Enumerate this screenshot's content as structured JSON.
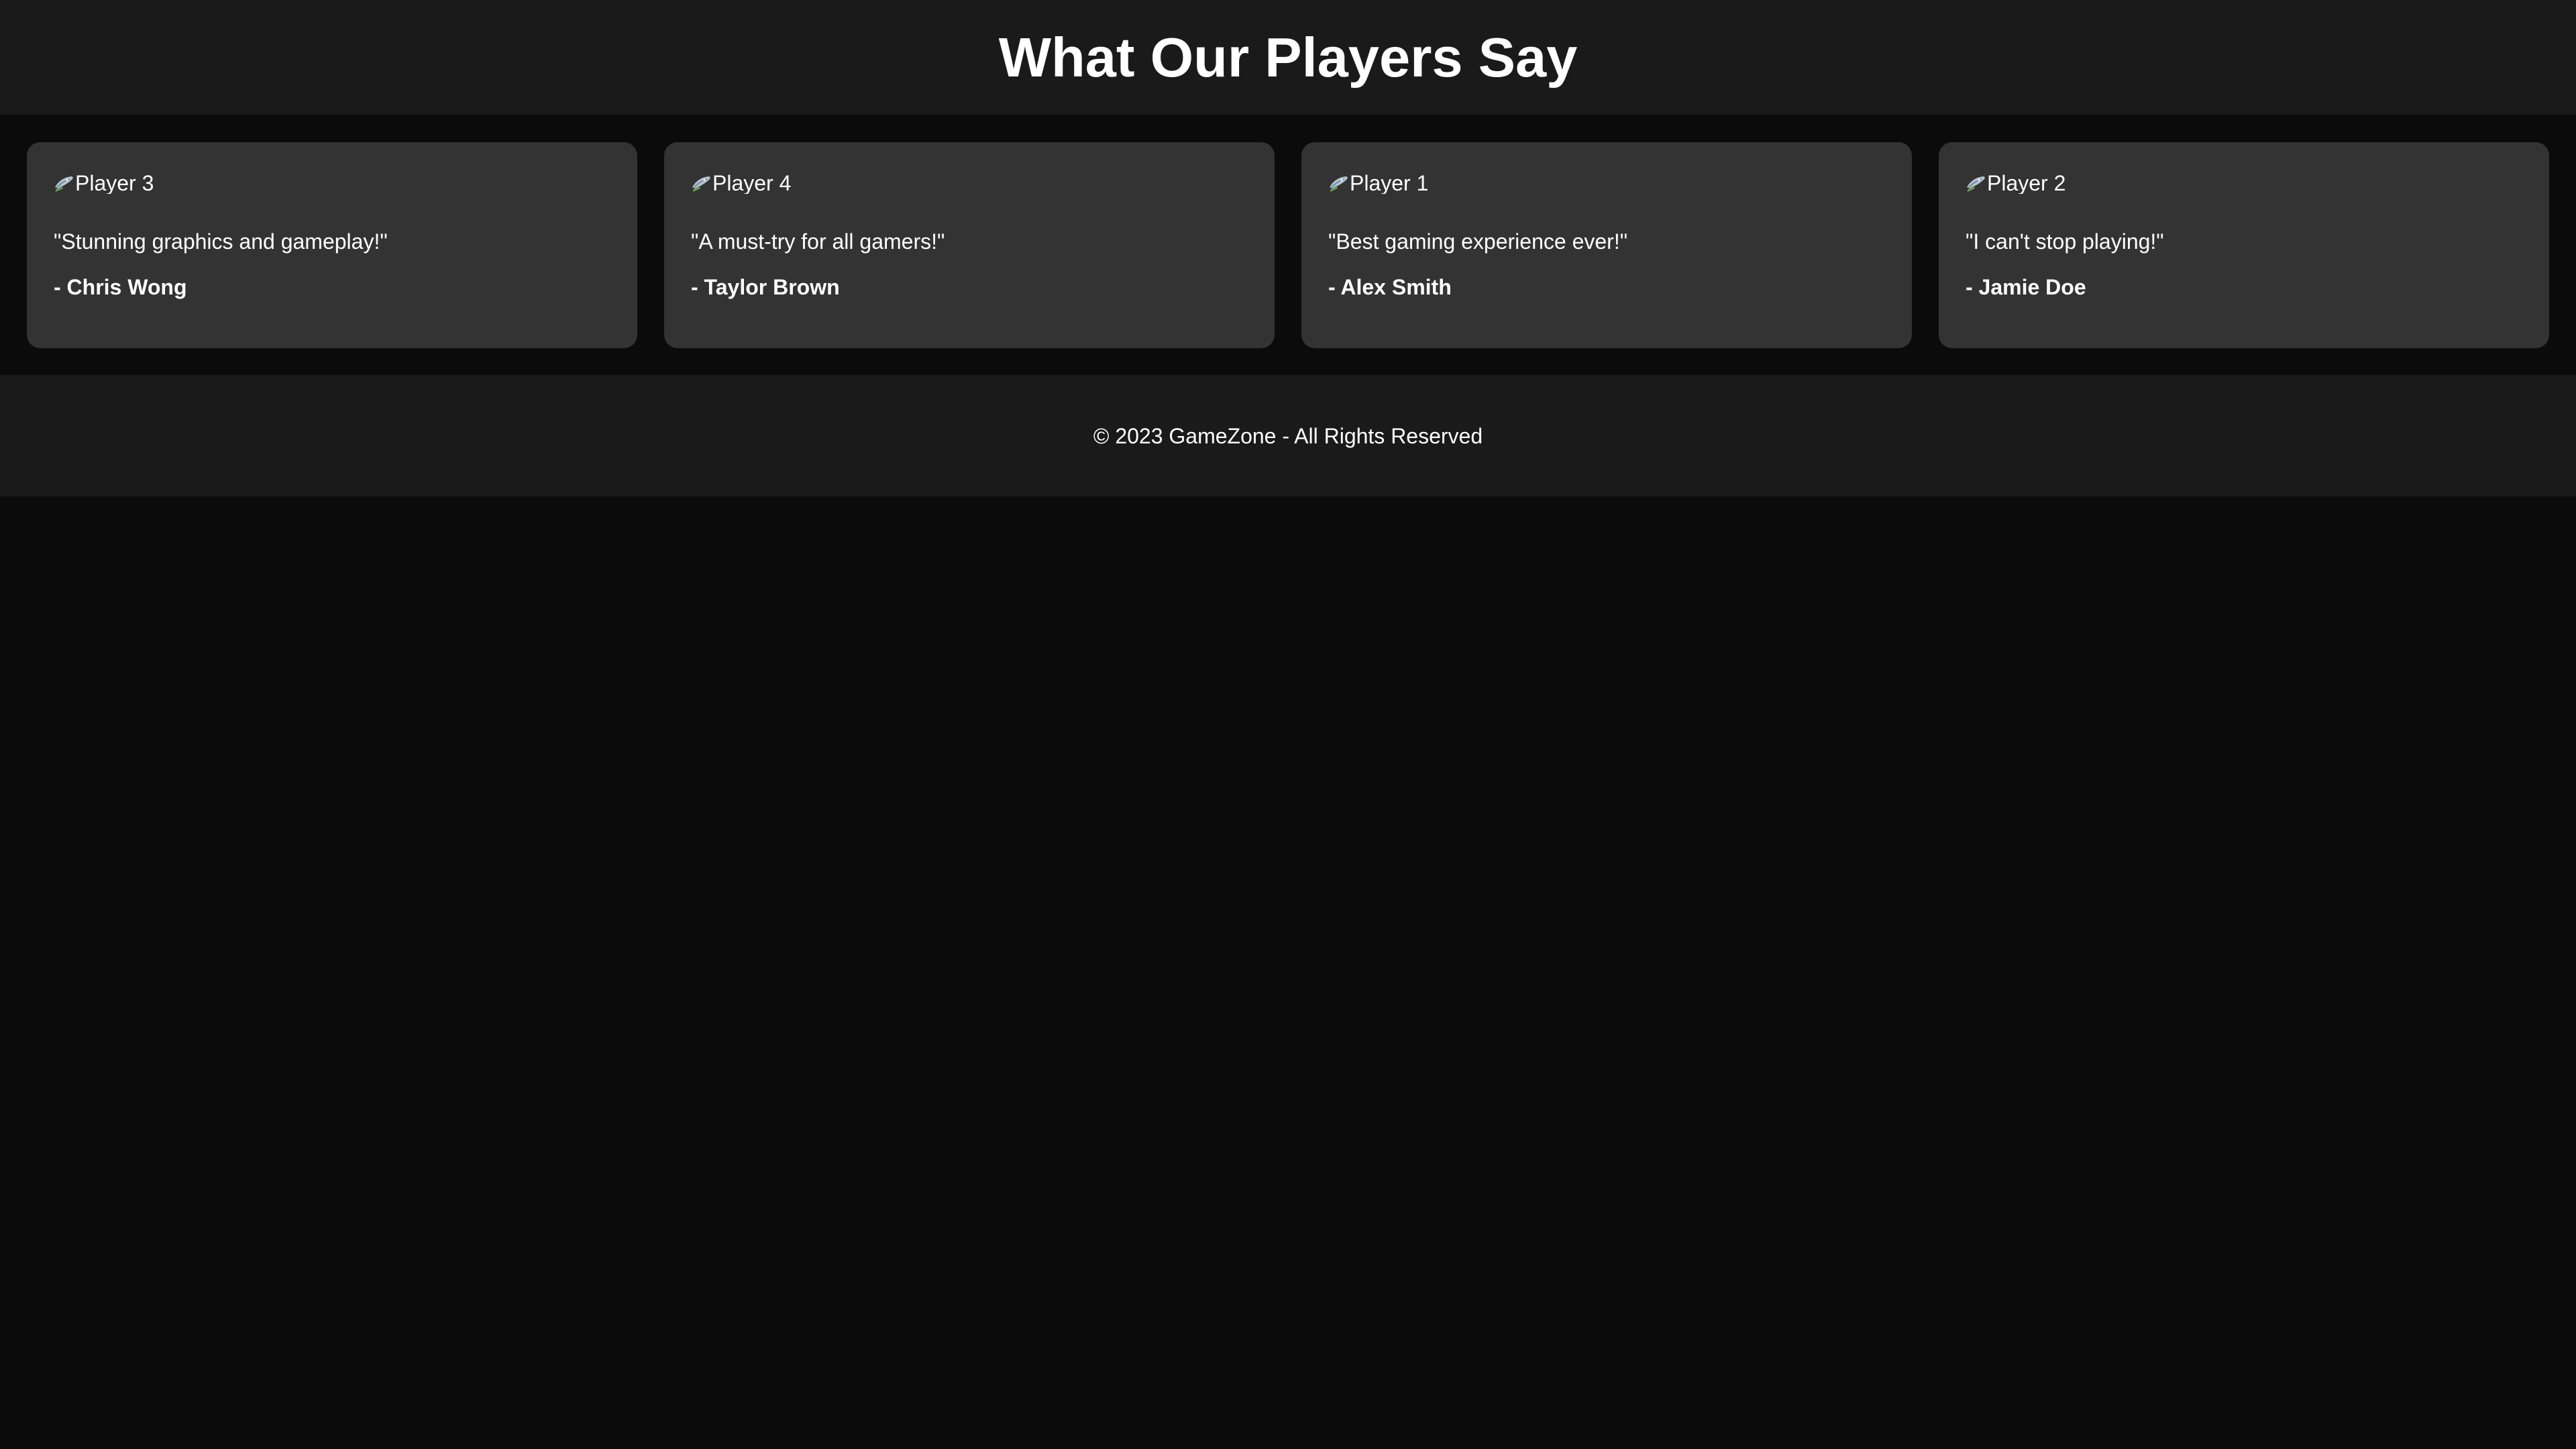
{
  "header": {
    "title": "What Our Players Say"
  },
  "testimonials": [
    {
      "avatar_alt": "Player 3",
      "avatar_icon": "broken-image-icon",
      "quote": "\"Stunning graphics and gameplay!\"",
      "author": "- Chris Wong"
    },
    {
      "avatar_alt": "Player 4",
      "avatar_icon": "broken-image-icon",
      "quote": "\"A must-try for all gamers!\"",
      "author": "- Taylor Brown"
    },
    {
      "avatar_alt": "Player 1",
      "avatar_icon": "broken-image-icon",
      "quote": "\"Best gaming experience ever!\"",
      "author": "- Alex Smith"
    },
    {
      "avatar_alt": "Player 2",
      "avatar_icon": "broken-image-icon",
      "quote": "\"I can't stop playing!\"",
      "author": "- Jamie Doe"
    }
  ],
  "footer": {
    "text": "© 2023 GameZone - All Rights Reserved"
  },
  "colors": {
    "page_background": "#0b0b0b",
    "header_background": "#1a1a1a",
    "card_background": "#333333",
    "text": "#ffffff"
  }
}
